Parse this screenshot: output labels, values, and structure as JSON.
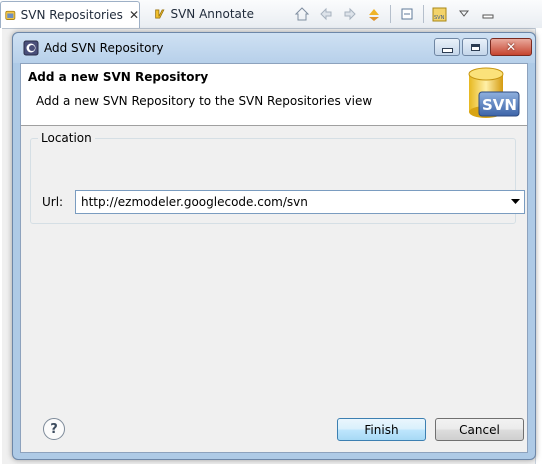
{
  "background": {
    "tabs": [
      {
        "label": "SVN Repositories",
        "close": "✕",
        "active": true
      },
      {
        "label": "SVN Annotate",
        "active": false
      }
    ]
  },
  "dialog": {
    "title": "Add SVN Repository",
    "controls": {
      "close_glyph": "✕"
    },
    "wizard": {
      "title": "Add a new SVN Repository",
      "description": "Add a new SVN Repository to the SVN Repositories view",
      "banner_text": "SVN"
    },
    "location_group": {
      "label": "Location",
      "url_label": "Url:",
      "url_value": "http://ezmodeler.googlecode.com/svn"
    },
    "buttons": {
      "help": "?",
      "finish": "Finish",
      "cancel": "Cancel"
    }
  },
  "colors": {
    "dialog_frame": "#aecae6",
    "client_bg": "#f0f0f0",
    "default_button": "#a7d9f5",
    "close_button": "#c6442f"
  }
}
